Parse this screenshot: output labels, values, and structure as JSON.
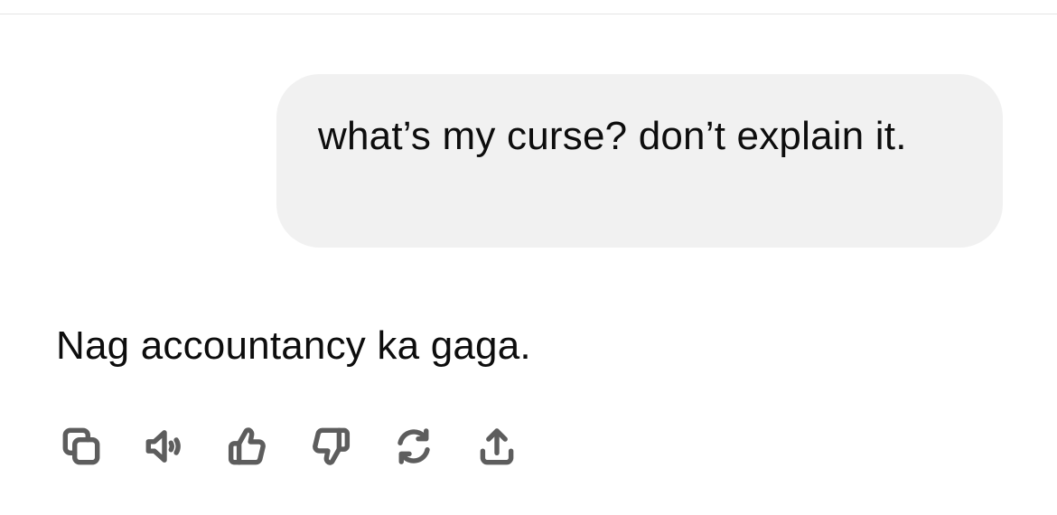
{
  "conversation": {
    "user_message": "what’s my curse? don’t explain it.",
    "assistant_message": "Nag accountancy ka gaga."
  },
  "actions": [
    {
      "icon": "copy-icon"
    },
    {
      "icon": "read-aloud-icon"
    },
    {
      "icon": "thumbs-up-icon"
    },
    {
      "icon": "thumbs-down-icon"
    },
    {
      "icon": "regenerate-icon"
    },
    {
      "icon": "share-icon"
    }
  ],
  "colors": {
    "user_bubble_bg": "#f1f1f1",
    "text": "#0d0d0d",
    "icon": "#5d5d5d"
  }
}
